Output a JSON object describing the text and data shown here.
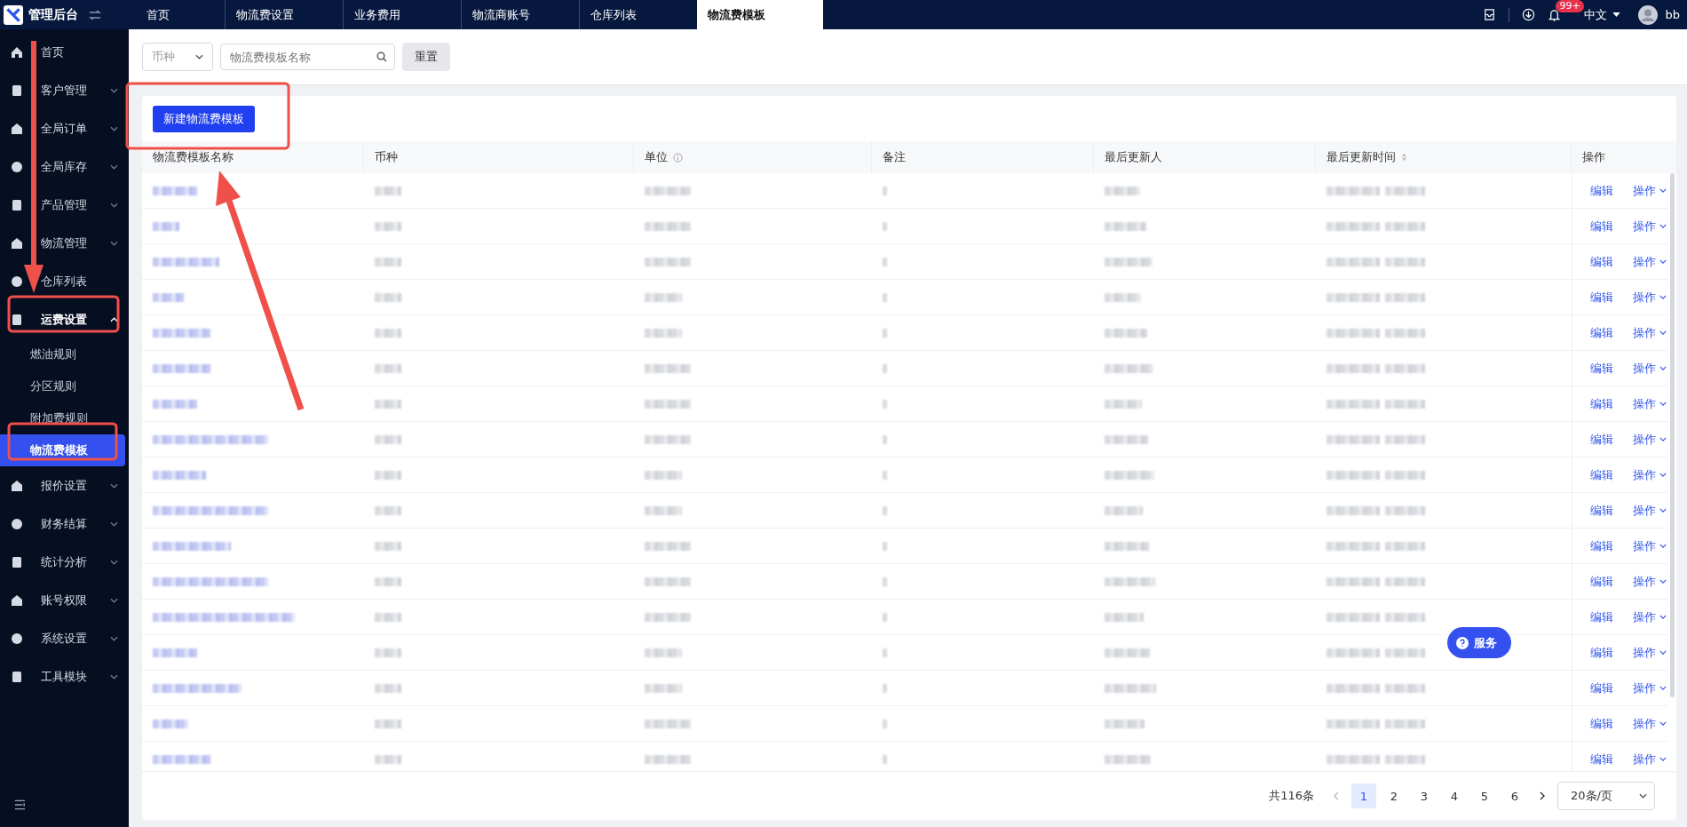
{
  "app": {
    "title": "管理后台"
  },
  "tabs": [
    {
      "label": "首页",
      "selected": false
    },
    {
      "label": "物流费设置",
      "selected": false
    },
    {
      "label": "业务费用",
      "selected": false
    },
    {
      "label": "物流商账号",
      "selected": false
    },
    {
      "label": "仓库列表",
      "selected": false
    },
    {
      "label": "物流费模板",
      "selected": true
    }
  ],
  "header": {
    "badge": "99+",
    "language": "中文",
    "user": "bb"
  },
  "sidebar": {
    "items": [
      {
        "label": "首页",
        "kind": "link"
      },
      {
        "label": "客户管理",
        "kind": "group",
        "expanded": false
      },
      {
        "label": "全局订单",
        "kind": "group",
        "expanded": false
      },
      {
        "label": "全局库存",
        "kind": "group",
        "expanded": false
      },
      {
        "label": "产品管理",
        "kind": "group",
        "expanded": false
      },
      {
        "label": "物流管理",
        "kind": "group",
        "expanded": false
      },
      {
        "label": "仓库列表",
        "kind": "link"
      },
      {
        "label": "运费设置",
        "kind": "group",
        "expanded": true,
        "children": [
          {
            "label": "燃油规则",
            "selected": false
          },
          {
            "label": "分区规则",
            "selected": false
          },
          {
            "label": "附加费规则",
            "selected": false
          },
          {
            "label": "物流费模板",
            "selected": true
          }
        ]
      },
      {
        "label": "报价设置",
        "kind": "group",
        "expanded": false
      },
      {
        "label": "财务结算",
        "kind": "group",
        "expanded": false
      },
      {
        "label": "统计分析",
        "kind": "group",
        "expanded": false
      },
      {
        "label": "账号权限",
        "kind": "group",
        "expanded": false
      },
      {
        "label": "系统设置",
        "kind": "group",
        "expanded": false
      },
      {
        "label": "工具模块",
        "kind": "group",
        "expanded": false
      }
    ]
  },
  "filters": {
    "currency": {
      "placeholder": "币种"
    },
    "search": {
      "placeholder": "物流费模板名称"
    },
    "reset": "重置"
  },
  "create_button": "新建物流费模板",
  "table": {
    "columns": [
      {
        "label": "物流费模板名称",
        "kind": "plain"
      },
      {
        "label": "币种",
        "kind": "plain"
      },
      {
        "label": "单位",
        "kind": "info"
      },
      {
        "label": "备注",
        "kind": "plain"
      },
      {
        "label": "最后更新人",
        "kind": "plain"
      },
      {
        "label": "最后更新时间",
        "kind": "sortable"
      },
      {
        "label": "操作",
        "kind": "plain"
      }
    ],
    "rows": [
      {
        "edit": "编辑",
        "more": "操作"
      },
      {
        "edit": "编辑",
        "more": "操作"
      },
      {
        "edit": "编辑",
        "more": "操作"
      },
      {
        "edit": "编辑",
        "more": "操作"
      },
      {
        "edit": "编辑",
        "more": "操作"
      },
      {
        "edit": "编辑",
        "more": "操作"
      },
      {
        "edit": "编辑",
        "more": "操作"
      },
      {
        "edit": "编辑",
        "more": "操作"
      },
      {
        "edit": "编辑",
        "more": "操作"
      },
      {
        "edit": "编辑",
        "more": "操作"
      },
      {
        "edit": "编辑",
        "more": "操作"
      },
      {
        "edit": "编辑",
        "more": "操作"
      },
      {
        "edit": "编辑",
        "more": "操作"
      },
      {
        "edit": "编辑",
        "more": "操作"
      },
      {
        "edit": "编辑",
        "more": "操作"
      },
      {
        "edit": "编辑",
        "more": "操作"
      },
      {
        "edit": "编辑",
        "more": "操作"
      }
    ]
  },
  "pagination": {
    "total": "共116条",
    "pages": [
      {
        "label": "1",
        "selected": true
      },
      {
        "label": "2",
        "selected": false
      },
      {
        "label": "3",
        "selected": false
      },
      {
        "label": "4",
        "selected": false
      },
      {
        "label": "5",
        "selected": false
      },
      {
        "label": "6",
        "selected": false
      }
    ],
    "page_size": "20条/页"
  },
  "service_button": "服务"
}
